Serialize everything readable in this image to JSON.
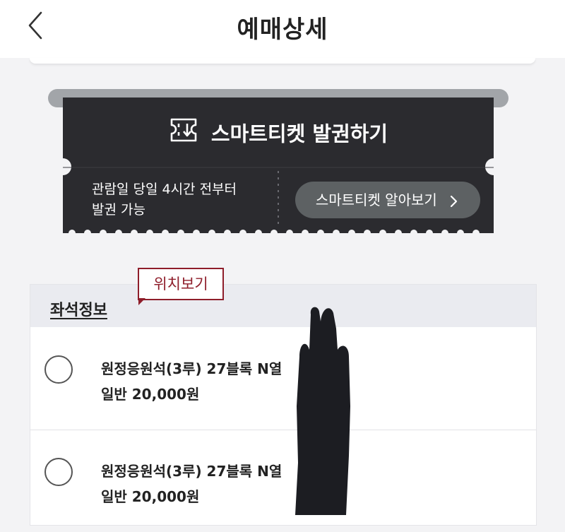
{
  "header": {
    "title": "예매상세",
    "back_icon": "chevron-left-icon"
  },
  "ticket": {
    "title": "스마트티켓 발권하기",
    "icon": "smart-ticket-icon",
    "note_line1": "관람일 당일 4시간 전부터",
    "note_line2": "발권 가능",
    "learn_button": "스마트티켓 알아보기",
    "learn_icon": "chevron-right-icon",
    "colors": {
      "ticket_bg": "#2b2b2f",
      "button_bg": "#5d6163",
      "roller": "#a2a5a9"
    }
  },
  "seat_section": {
    "header_label": "좌석정보",
    "tooltip": "위치보기",
    "tooltip_color": "#8e1d2a",
    "seats": [
      {
        "name": "원정응원석(3루) 27블록 N열",
        "price": "일반 20,000원"
      },
      {
        "name": "원정응원석(3루) 27블록 N열",
        "price": "일반 20,000원"
      }
    ]
  }
}
